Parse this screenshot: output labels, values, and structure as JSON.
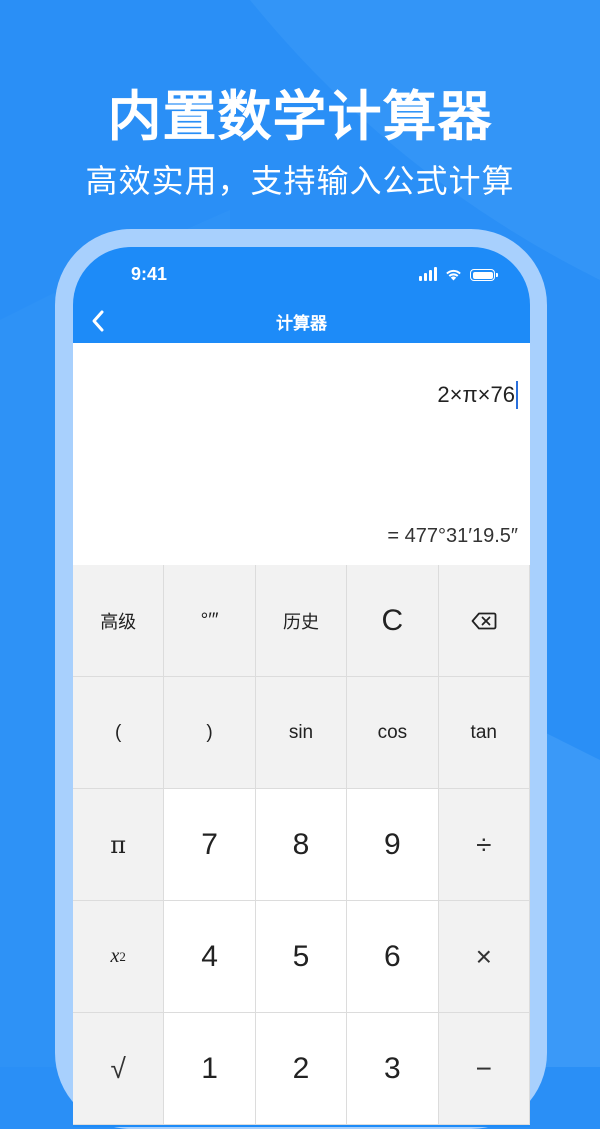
{
  "headline": "内置数学计算器",
  "subheadline": "高效实用，支持输入公式计算",
  "colors": {
    "background": "#2a8ff6",
    "phone_frame": "#a8d0fd",
    "app_bar": "#1d8bf8",
    "function_key": "#f2f2f2",
    "number_key": "#ffffff"
  },
  "status_bar": {
    "time": "9:41",
    "icons": [
      "signal-icon",
      "wifi-icon",
      "battery-icon"
    ],
    "battery_level": 1.0
  },
  "nav": {
    "title": "计算器",
    "back_icon": "chevron-left-icon"
  },
  "display": {
    "expression": "2×π×76",
    "result": "= 477°31′19.5″"
  },
  "keypad": {
    "row1": [
      "高级",
      "°′″",
      "历史",
      "C",
      "backspace-icon"
    ],
    "row2": [
      "(",
      ")",
      "sin",
      "cos",
      "tan"
    ],
    "row3": [
      "π",
      "7",
      "8",
      "9",
      "÷"
    ],
    "row4": [
      "x",
      "4",
      "5",
      "6",
      "×"
    ],
    "row5": [
      "√",
      "1",
      "2",
      "3",
      "−"
    ],
    "x2_exponent": "2"
  }
}
